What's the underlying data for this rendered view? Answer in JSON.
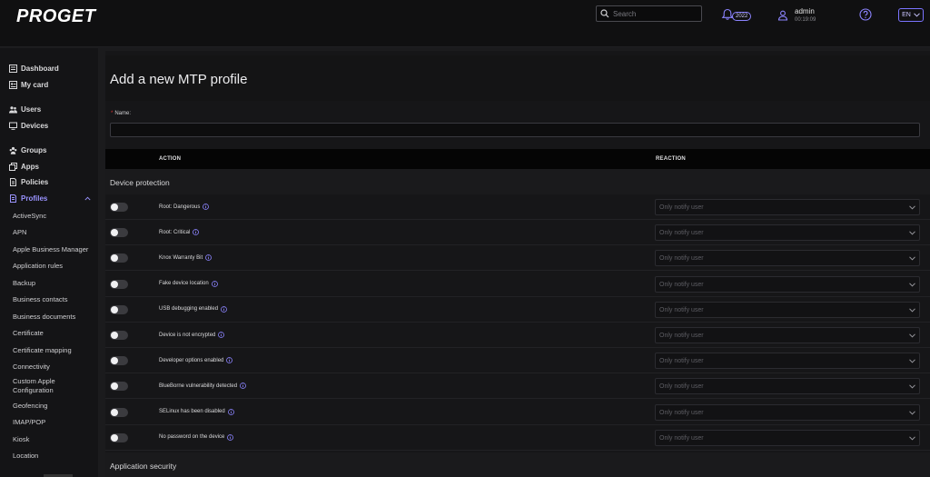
{
  "app": {
    "logo": "PROGET",
    "search_placeholder": "Search",
    "notification_count": "2022",
    "user_name": "admin",
    "user_time": "00:19:09",
    "language": "EN"
  },
  "sidebar": {
    "groups": [
      [
        {
          "label": "Dashboard",
          "icon": "dashboard-icon"
        },
        {
          "label": "My card",
          "icon": "card-icon"
        }
      ],
      [
        {
          "label": "Users",
          "icon": "users-icon"
        },
        {
          "label": "Devices",
          "icon": "devices-icon"
        }
      ],
      [
        {
          "label": "Groups",
          "icon": "groups-icon"
        },
        {
          "label": "Apps",
          "icon": "apps-icon"
        },
        {
          "label": "Policies",
          "icon": "policies-icon"
        },
        {
          "label": "Profiles",
          "icon": "profiles-icon",
          "active": true
        }
      ]
    ],
    "profiles_sub": [
      "ActiveSync",
      "APN",
      "Apple Business Manager",
      "Application rules",
      "Backup",
      "Business contacts",
      "Business documents",
      "Certificate",
      "Certificate mapping",
      "Connectivity",
      "Custom Apple Configuration",
      "Geofencing",
      "IMAP/POP",
      "Kiosk",
      "Location"
    ]
  },
  "page": {
    "title": "Add a new MTP profile",
    "name_label": "Name:",
    "name_required_mark": "*",
    "name_value": ""
  },
  "table": {
    "header_action": "ACTION",
    "header_reaction": "REACTION",
    "section_device": "Device protection",
    "section_app": "Application security",
    "rows": [
      {
        "action": "Root: Dangerous",
        "reaction": "Only notify user",
        "enabled": false
      },
      {
        "action": "Root: Critical",
        "reaction": "Only notify user",
        "enabled": false
      },
      {
        "action": "Knox Warranty Bit",
        "reaction": "Only notify user",
        "enabled": false
      },
      {
        "action": "Fake device location",
        "reaction": "Only notify user",
        "enabled": false
      },
      {
        "action": "USB debugging enabled",
        "reaction": "Only notify user",
        "enabled": false
      },
      {
        "action": "Device is not encrypted",
        "reaction": "Only notify user",
        "enabled": false
      },
      {
        "action": "Developer options enabled",
        "reaction": "Only notify user",
        "enabled": false
      },
      {
        "action": "BlueBorne vulnerability detected",
        "reaction": "Only notify user",
        "enabled": false
      },
      {
        "action": "SELinux has been disabled",
        "reaction": "Only notify user",
        "enabled": false
      },
      {
        "action": "No password on the device",
        "reaction": "Only notify user",
        "enabled": false
      }
    ]
  },
  "colors": {
    "accent": "#8c84ff",
    "background": "#1b1b1d",
    "topbar": "#101011"
  }
}
